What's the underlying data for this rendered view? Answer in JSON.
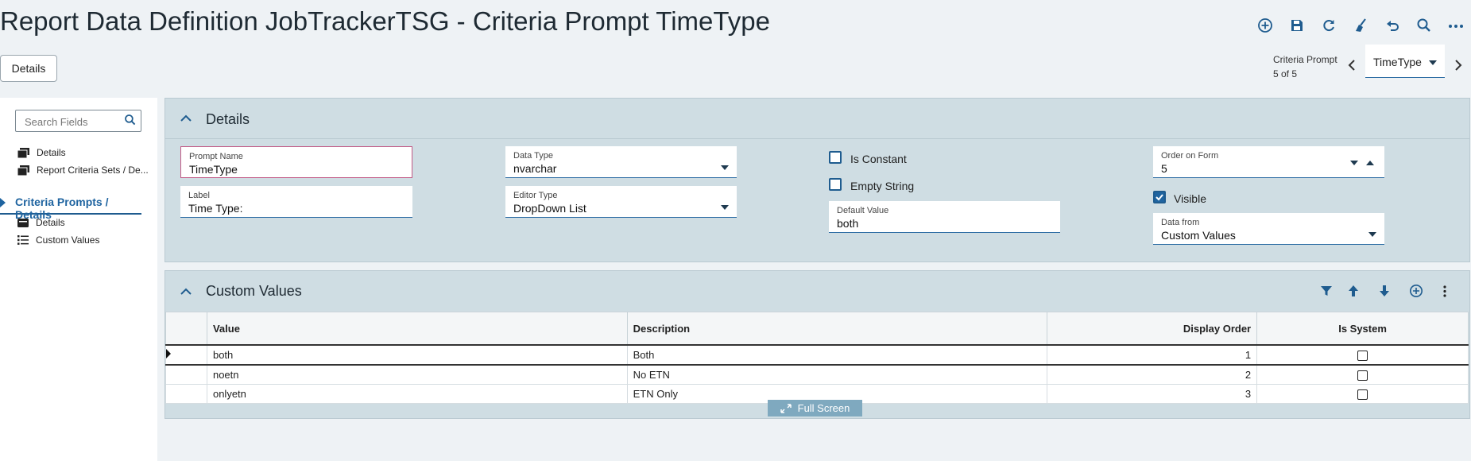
{
  "page": {
    "title": "Report Data Definition JobTrackerTSG - Criteria Prompt TimeType"
  },
  "top": {
    "details_button": "Details"
  },
  "toolbar": {
    "icons": [
      "add-icon",
      "save-icon",
      "refresh-icon",
      "clear-icon",
      "undo-icon",
      "search-icon",
      "more-icon"
    ]
  },
  "criteria_nav": {
    "label": "Criteria Prompt",
    "position": "5 of 5",
    "selected": "TimeType"
  },
  "sidebar": {
    "search_placeholder": "Search Fields",
    "items": [
      {
        "label": "Details",
        "icon": "stack-icon"
      },
      {
        "label": "Report Criteria Sets / De...",
        "icon": "stack-icon"
      }
    ],
    "active_section": "Criteria Prompts / Details",
    "sub_items": [
      {
        "label": "Details",
        "icon": "card-icon"
      },
      {
        "label": "Custom Values",
        "icon": "list-icon"
      }
    ]
  },
  "details_panel": {
    "title": "Details",
    "prompt_name": {
      "label": "Prompt Name",
      "value": "TimeType"
    },
    "label_field": {
      "label": "Label",
      "value": "Time Type:"
    },
    "data_type": {
      "label": "Data Type",
      "value": "nvarchar"
    },
    "editor_type": {
      "label": "Editor Type",
      "value": "DropDown List"
    },
    "is_constant": {
      "label": "Is Constant",
      "checked": false
    },
    "empty_string": {
      "label": "Empty String",
      "checked": false
    },
    "default_value": {
      "label": "Default Value",
      "value": "both"
    },
    "order_on_form": {
      "label": "Order on Form",
      "value": "5"
    },
    "visible": {
      "label": "Visible",
      "checked": true
    },
    "data_from": {
      "label": "Data from",
      "value": "Custom Values"
    }
  },
  "custom_values": {
    "title": "Custom Values",
    "columns": {
      "value": "Value",
      "description": "Description",
      "display_order": "Display Order",
      "is_system": "Is System"
    },
    "rows": [
      {
        "value": "both",
        "description": "Both",
        "display_order": "1",
        "is_system": false
      },
      {
        "value": "noetn",
        "description": "No ETN",
        "display_order": "2",
        "is_system": false
      },
      {
        "value": "onlyetn",
        "description": "ETN Only",
        "display_order": "3",
        "is_system": false
      }
    ],
    "full_screen_label": "Full Screen"
  },
  "colors": {
    "accent": "#1f64a0",
    "panel": "#cfdde3",
    "background": "#eef2f5"
  }
}
